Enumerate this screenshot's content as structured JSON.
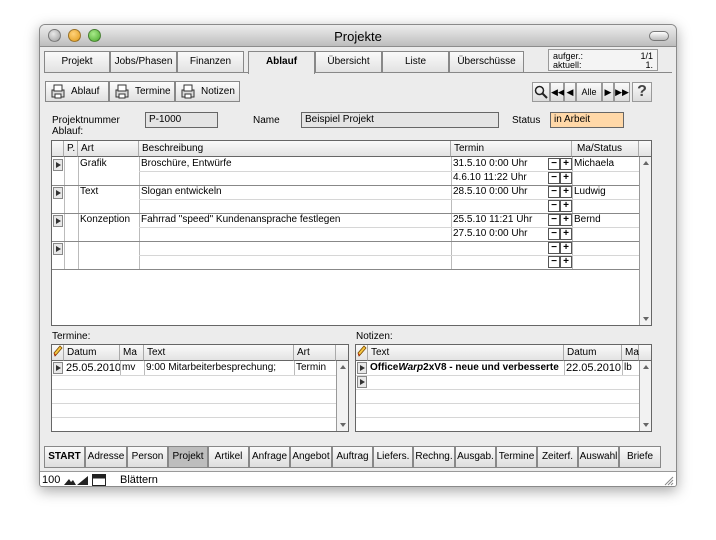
{
  "window": {
    "title": "Projekte"
  },
  "tabs": [
    "Projekt",
    "Jobs/Phasen",
    "Finanzen",
    "Ablauf",
    "Übersicht",
    "Liste",
    "Überschüsse"
  ],
  "active_tab": "Ablauf",
  "pager": {
    "found_label": "aufger.:",
    "found_value": "1/1",
    "current_label": "aktuell:",
    "current_value": "1."
  },
  "toolbar": {
    "ablauf": "Ablauf",
    "termine": "Termine",
    "notizen": "Notizen",
    "alle": "Alle",
    "help": "?"
  },
  "form": {
    "projektnummer_label": "Projektnummer",
    "projektnummer": "P-1000",
    "name_label": "Name",
    "name": "Beispiel Projekt",
    "status_label": "Status",
    "status": "in Arbeit",
    "status_color": "#ffd8a8",
    "ablauf_label": "Ablauf:"
  },
  "ablauf": {
    "columns": [
      "P.",
      "Art",
      "Beschreibung",
      "Termin",
      "Ma/Status"
    ],
    "rows": [
      {
        "art": "Grafik",
        "beschreibung": "Broschüre, Entwürfe",
        "termine": [
          "31.5.10 0:00 Uhr",
          "4.6.10 11:22 Uhr"
        ],
        "ma": "Michaela"
      },
      {
        "art": "Text",
        "beschreibung": "Slogan entwickeln",
        "termine": [
          "28.5.10 0:00 Uhr",
          ""
        ],
        "ma": "Ludwig"
      },
      {
        "art": "Konzeption",
        "beschreibung": "Fahrrad \"speed\" Kundenansprache festlegen",
        "termine": [
          "25.5.10 11:21 Uhr",
          "27.5.10 0:00 Uhr"
        ],
        "ma": "Bernd"
      },
      {
        "art": "",
        "beschreibung": "",
        "termine": [
          "",
          ""
        ],
        "ma": ""
      }
    ]
  },
  "termine": {
    "label": "Termine:",
    "columns": [
      "Datum",
      "Ma",
      "Text",
      "Art"
    ],
    "rows": [
      {
        "datum": "25.05.2010",
        "ma": "mv",
        "text": "9:00 Mitarbeiterbesprechung;",
        "art": "Termin"
      }
    ]
  },
  "notizen": {
    "label": "Notizen:",
    "columns": [
      "Text",
      "Datum",
      "Ma"
    ],
    "rows": [
      {
        "text_a": "Office",
        "text_b": "Warp",
        "text_c": "2xV8 - neue und verbesserte",
        "datum": "22.05.2010",
        "ma": "lb"
      }
    ]
  },
  "bottom_nav": [
    "START",
    "Adresse",
    "Person",
    "Projekt",
    "Artikel",
    "Anfrage",
    "Angebot",
    "Auftrag",
    "Liefers.",
    "Rechng.",
    "Ausgab.",
    "Termine",
    "Zeiterf.",
    "Auswahl",
    "Briefe"
  ],
  "bottom_active": "Projekt",
  "statusbar": {
    "zoom": "100",
    "mode": "Blättern"
  }
}
